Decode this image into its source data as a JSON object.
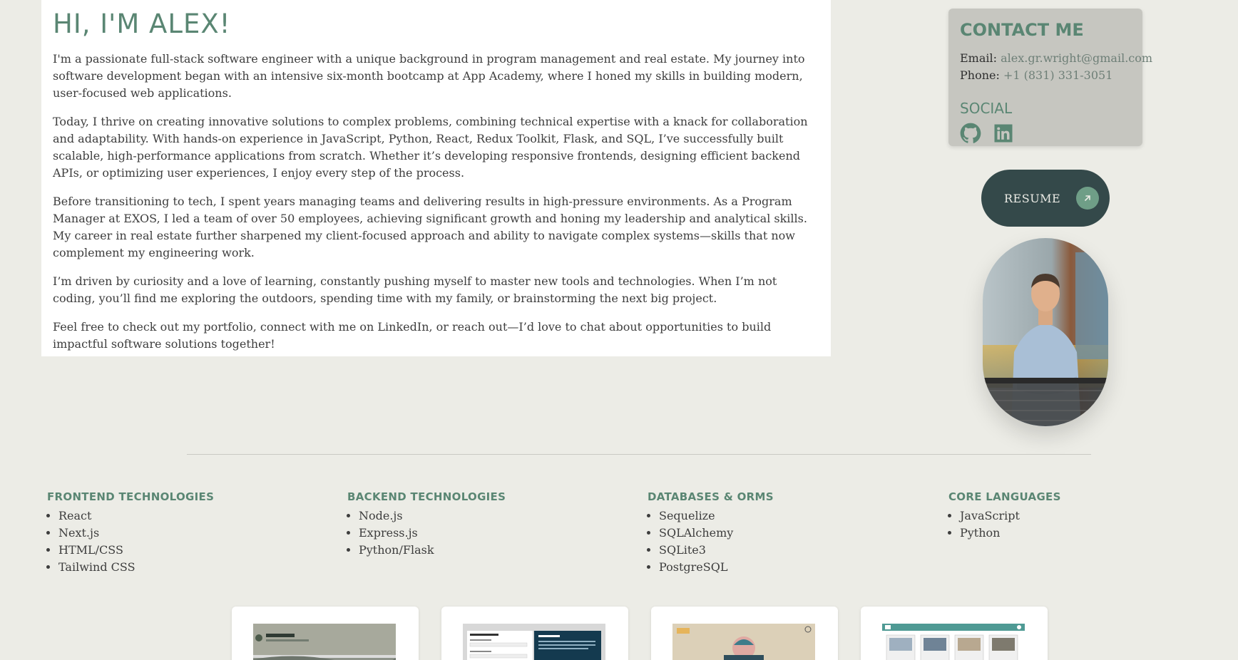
{
  "about": {
    "heading": "HI, I'M ALEX!",
    "paragraphs": [
      "I'm a passionate full-stack software engineer with a unique background in program management and real estate. My journey into software development began with an intensive six-month bootcamp at App Academy, where I honed my skills in building modern, user-focused web applications.",
      "Today, I thrive on creating innovative solutions to complex problems, combining technical expertise with a knack for collaboration and adaptability. With hands-on experience in JavaScript, Python, React, Redux Toolkit, Flask, and SQL, I’ve successfully built scalable, high-performance applications from scratch. Whether it’s developing responsive frontends, designing efficient backend APIs, or optimizing user experiences, I enjoy every step of the process.",
      "Before transitioning to tech, I spent years managing teams and delivering results in high-pressure environments. As a Program Manager at EXOS, I led a team of over 50 employees, achieving significant growth and honing my leadership and analytical skills. My career in real estate further sharpened my client-focused approach and ability to navigate complex systems—skills that now complement my engineering work.",
      "I’m driven by curiosity and a love of learning, constantly pushing myself to master new tools and technologies. When I’m not coding, you’ll find me exploring the outdoors, spending time with my family, or brainstorming the next big project.",
      "Feel free to check out my portfolio, connect with me on LinkedIn, or reach out—I’d love to chat about opportunities to build impactful software solutions together!"
    ]
  },
  "contact": {
    "heading": "CONTACT ME",
    "email_label": "Email:",
    "email_value": "alex.gr.wright@gmail.com",
    "phone_label": "Phone:",
    "phone_value": "+1 (831) 331-3051",
    "social_heading": "SOCIAL",
    "social_icons": [
      "github-icon",
      "linkedin-icon"
    ]
  },
  "resume": {
    "label": "RESUME",
    "icon": "arrow-up-right-icon"
  },
  "tech": [
    {
      "heading": "FRONTEND TECHNOLOGIES",
      "items": [
        "React",
        "Next.js",
        "HTML/CSS",
        "Tailwind CSS"
      ]
    },
    {
      "heading": "BACKEND TECHNOLOGIES",
      "items": [
        "Node.js",
        "Express.js",
        "Python/Flask"
      ]
    },
    {
      "heading": "DATABASES & ORMS",
      "items": [
        "Sequelize",
        "SQLAlchemy",
        "SQLite3",
        "PostgreSQL"
      ]
    },
    {
      "heading": "CORE LANGUAGES",
      "items": [
        "JavaScript",
        "Python"
      ]
    }
  ],
  "colors": {
    "accent": "#5a8673",
    "background": "#ecece6",
    "contact_card": "#c6c6c0",
    "resume_button": "#34494a",
    "resume_arrow": "#6f9e87"
  }
}
